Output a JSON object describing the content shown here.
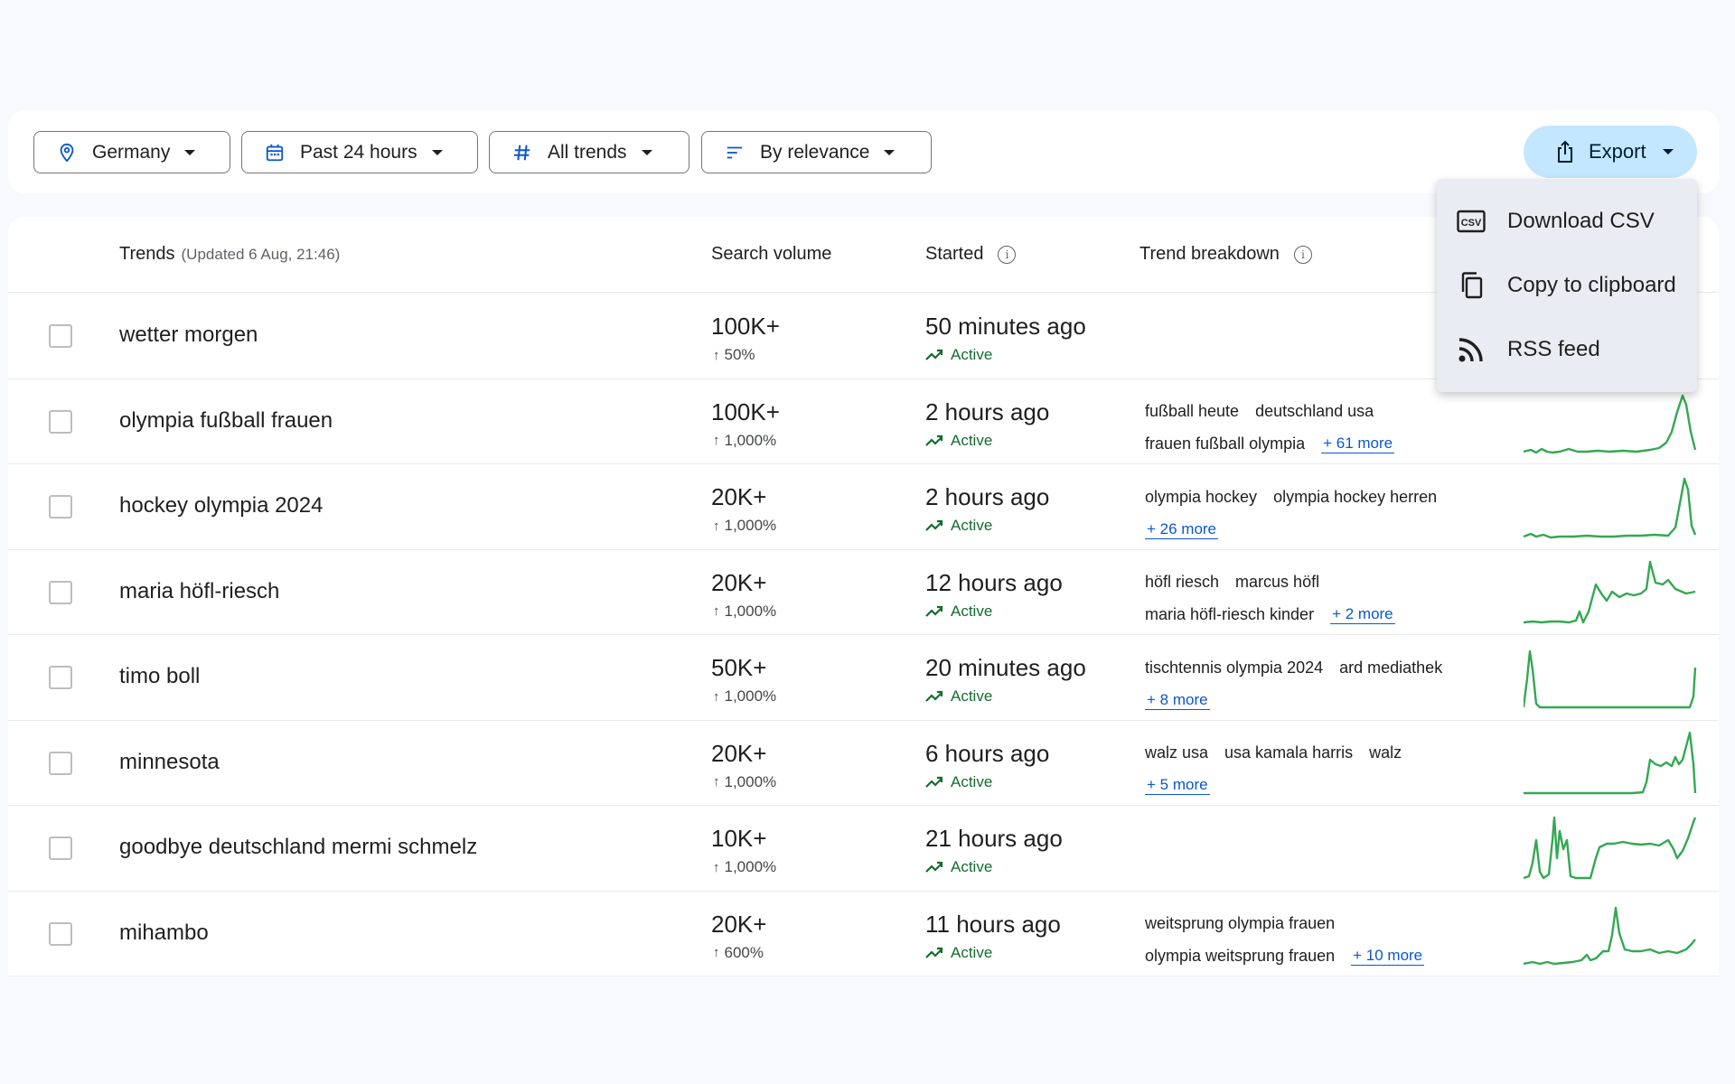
{
  "filters": {
    "location": "Germany",
    "time": "Past 24 hours",
    "category": "All trends",
    "sort": "By relevance"
  },
  "export": {
    "label": "Export",
    "menu": [
      "Download CSV",
      "Copy to clipboard",
      "RSS feed"
    ],
    "csv_icon_text": "CSV"
  },
  "table": {
    "headers": {
      "trends": "Trends",
      "updated": "(Updated 6 Aug, 21:46)",
      "volume": "Search volume",
      "started": "Started",
      "breakdown": "Trend breakdown"
    },
    "info_glyph": "i",
    "rows": [
      {
        "term": "wetter morgen",
        "volume": "100K+",
        "increase": "50%",
        "started": "50 minutes ago",
        "status": "Active",
        "breakdown": [],
        "more": ""
      },
      {
        "term": "olympia fußball frauen",
        "volume": "100K+",
        "increase": "1,000%",
        "started": "2 hours ago",
        "status": "Active",
        "breakdown": [
          [
            "fußball heute",
            "deutschland usa"
          ],
          [
            "frauen fußball olympia"
          ]
        ],
        "more": "+ 61 more"
      },
      {
        "term": "hockey olympia 2024",
        "volume": "20K+",
        "increase": "1,000%",
        "started": "2 hours ago",
        "status": "Active",
        "breakdown": [
          [
            "olympia hockey",
            "olympia hockey herren"
          ],
          []
        ],
        "more": "+ 26 more"
      },
      {
        "term": "maria höfl-riesch",
        "volume": "20K+",
        "increase": "1,000%",
        "started": "12 hours ago",
        "status": "Active",
        "breakdown": [
          [
            "höfl riesch",
            "marcus höfl"
          ],
          [
            "maria höfl-riesch kinder"
          ]
        ],
        "more": "+ 2 more"
      },
      {
        "term": "timo boll",
        "volume": "50K+",
        "increase": "1,000%",
        "started": "20 minutes ago",
        "status": "Active",
        "breakdown": [
          [
            "tischtennis olympia 2024",
            "ard mediathek"
          ],
          []
        ],
        "more": "+ 8 more"
      },
      {
        "term": "minnesota",
        "volume": "20K+",
        "increase": "1,000%",
        "started": "6 hours ago",
        "status": "Active",
        "breakdown": [
          [
            "walz usa",
            "usa kamala harris",
            "walz"
          ],
          []
        ],
        "more": "+ 5 more"
      },
      {
        "term": "goodbye deutschland mermi schmelz",
        "volume": "10K+",
        "increase": "1,000%",
        "started": "21 hours ago",
        "status": "Active",
        "breakdown": [],
        "more": ""
      },
      {
        "term": "mihambo",
        "volume": "20K+",
        "increase": "600%",
        "started": "11 hours ago",
        "status": "Active",
        "breakdown": [
          [
            "weitsprung olympia frauen"
          ],
          [
            "olympia weitsprung frauen"
          ]
        ],
        "more": "+ 10 more"
      }
    ]
  },
  "colors": {
    "accent": "#0b57d0",
    "export_bg": "#c2e7ff",
    "spark": "#34a853",
    "active": "#146c2e"
  }
}
